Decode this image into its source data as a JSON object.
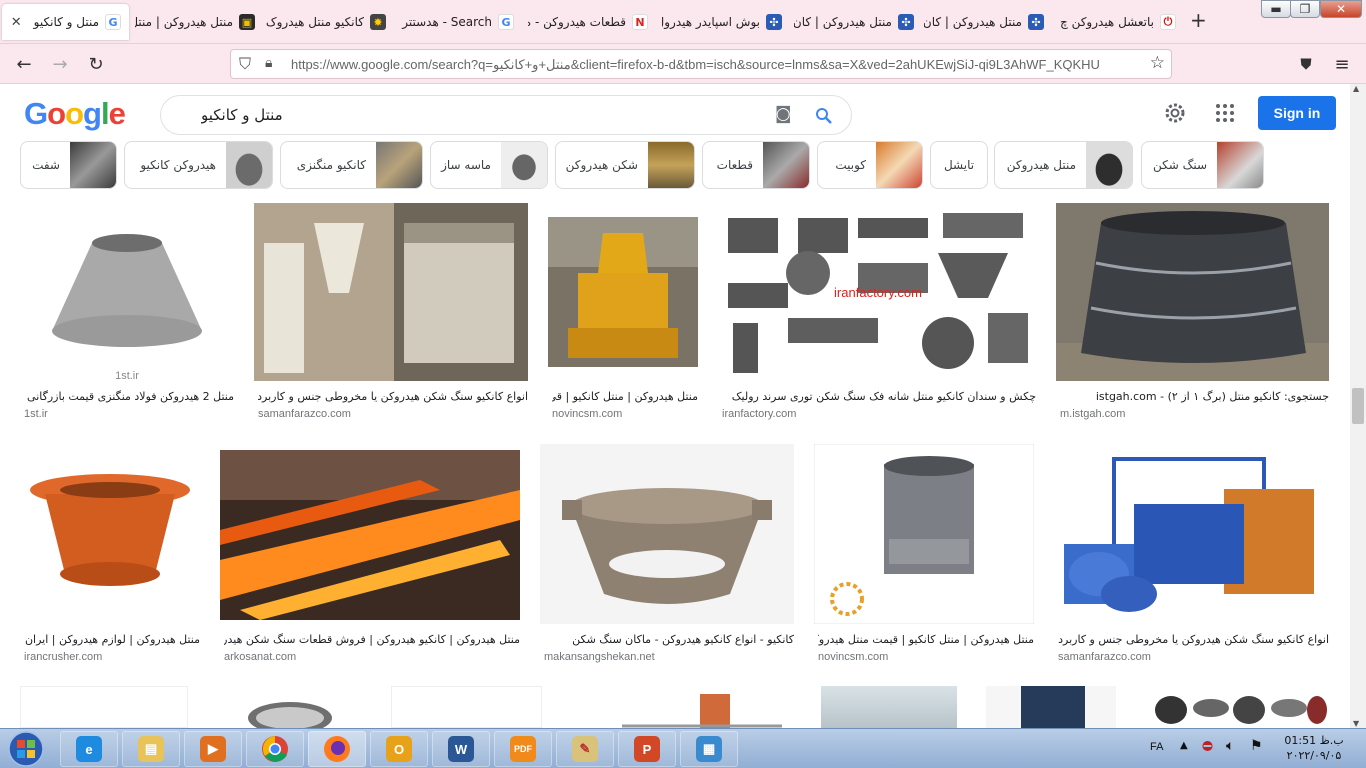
{
  "browser": {
    "tabs": [
      {
        "title": "منتل و کانکیو",
        "favicon": "google-icon",
        "active": true
      },
      {
        "title": "منتل هیدروکن | منتل",
        "favicon": "site-icon"
      },
      {
        "title": "کانکیو منتل هیدروک",
        "favicon": "gear-icon"
      },
      {
        "title": "Search - هدستتر",
        "favicon": "google-icon"
      },
      {
        "title": "قطعات هیدروکن - ه",
        "favicon": "nr-icon"
      },
      {
        "title": "بوش اسپایدر هیدرول",
        "favicon": "site-icon"
      },
      {
        "title": "منتل هیدروکن | کان",
        "favicon": "site-icon"
      },
      {
        "title": "منتل هیدروکن | کان",
        "favicon": "site-icon"
      },
      {
        "title": "باتعشل هیدروکن چ",
        "favicon": "power-icon"
      }
    ],
    "url": "https://www.google.com/search?q=منتل+و+کانکیو&client=firefox-b-d&tbm=isch&source=lnms&sa=X&ved=2ahUKEwjSiJ-qi9L3AhWF_KQKHU"
  },
  "google": {
    "logo_text": "Google",
    "search_query": "منتل و کانکیو",
    "signin_label": "Sign in",
    "chips": [
      {
        "label": "سنگ شکن",
        "color": "#b5412c"
      },
      {
        "label": "منتل هیدروکن",
        "color": "#2e2e2e"
      },
      {
        "label": "تایشل",
        "color": ""
      },
      {
        "label": "کوبیت",
        "color": "#d97b2b"
      },
      {
        "label": "قطعات",
        "color": "#555"
      },
      {
        "label": "شکن هیدروکن",
        "color": "#8a6a2a"
      },
      {
        "label": "ماسه ساز",
        "color": "#666"
      },
      {
        "label": "کانکیو منگنزی",
        "color": "#777"
      },
      {
        "label": "هیدروکن کانکیو",
        "color": "#6b6b6b"
      },
      {
        "label": "شفت",
        "color": "#3b3b3b"
      }
    ],
    "results_row1": [
      {
        "title": "منتل 2 هیدروکن فولاد منگنزی قیمت بازرگانی ...",
        "source": "1st.ir",
        "watermark": "1st.ir"
      },
      {
        "title": "انواع کانکیو سنگ شکن هیدروکن یا مخروطی جنس و کاربرد ه...",
        "source": "samanfarazco.com"
      },
      {
        "title": "منتل هیدروکن | منتل کانکیو | قی...",
        "source": "novincsm.com"
      },
      {
        "title": "چکش و سندان کانکیو منتل شانه فک سنگ شکن توری سرند رولیک",
        "source": "iranfactory.com",
        "watermark": "iranfactory.com"
      },
      {
        "title": "جستجوی: کانکیو منتل (برگ ۱ از ۲) - istgah.com",
        "source": "m.istgah.com"
      }
    ],
    "results_row2": [
      {
        "title": "منتل هیدروکن | لوازم هیدروکن | ایران ک...",
        "source": "irancrusher.com"
      },
      {
        "title": "منتل هیدروکن | کانکیو هیدروکن | فروش قطعات سنگ شکن هیدروکن ...",
        "source": "arkosanat.com"
      },
      {
        "title": "کانکیو - انواع کانکیو هیدروکن - ماکان سنگ شکن",
        "source": "makansangshekan.net"
      },
      {
        "title": "منتل هیدروکن | منتل کانکیو | قیمت منتل هیدروکن...",
        "source": "novincsm.com"
      },
      {
        "title": "انواع کانکیو سنگ شکن هیدروکن یا مخروطی جنس و کاربرد ه...",
        "source": "samanfarazco.com"
      }
    ]
  },
  "taskbar": {
    "language": "FA",
    "time": "01:51 ب.ظ",
    "date": "۲۰۲۲/۰۹/۰۵",
    "apps": [
      "start",
      "ie",
      "explorer",
      "media-player",
      "chrome",
      "firefox",
      "outlook",
      "word",
      "pdf",
      "paint",
      "powerpoint",
      "photo-viewer"
    ]
  },
  "colors": {
    "tab_bg": "#fbe7ee",
    "google_blue": "#1a73e8",
    "taskbar": "#a8c0e0"
  }
}
